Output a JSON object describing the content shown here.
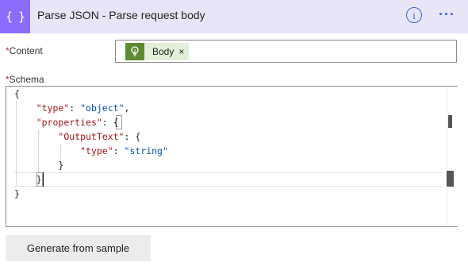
{
  "header": {
    "title": "Parse JSON - Parse request body",
    "action_icon": "{ }",
    "info_icon": "i",
    "more_icon": "···",
    "accent_color": "#8c6cff",
    "header_bg": "#e9e5f9"
  },
  "content_field": {
    "required_mark": "*",
    "label": "Content",
    "token": {
      "icon": "lightbulb-icon",
      "label": "Body",
      "remove": "×",
      "color": "#5f8a34"
    }
  },
  "schema_field": {
    "required_mark": "*",
    "label": "Schema",
    "code_lines": [
      "{",
      "    \"type\": \"object\",",
      "    \"properties\": {",
      "        \"OutputText\": {",
      "            \"type\": \"string\"",
      "        }",
      "    }",
      "}"
    ]
  },
  "generate_button": {
    "label": "Generate from sample"
  }
}
